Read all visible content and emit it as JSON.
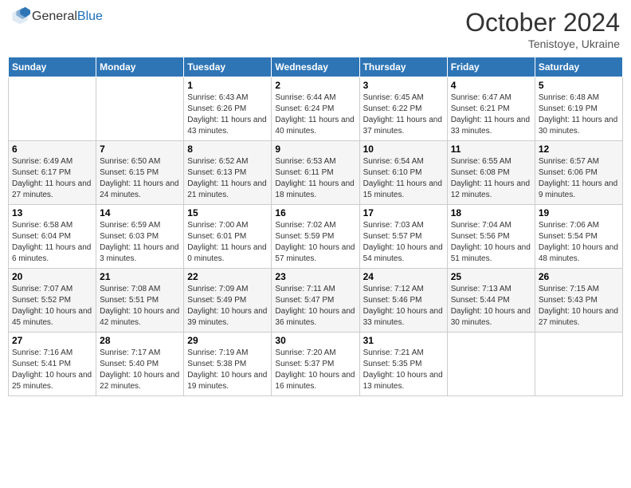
{
  "header": {
    "logo_general": "General",
    "logo_blue": "Blue",
    "month_title": "October 2024",
    "subtitle": "Tenistoye, Ukraine"
  },
  "days_of_week": [
    "Sunday",
    "Monday",
    "Tuesday",
    "Wednesday",
    "Thursday",
    "Friday",
    "Saturday"
  ],
  "weeks": [
    [
      {
        "day": "",
        "sunrise": "",
        "sunset": "",
        "daylight": ""
      },
      {
        "day": "",
        "sunrise": "",
        "sunset": "",
        "daylight": ""
      },
      {
        "day": "1",
        "sunrise": "Sunrise: 6:43 AM",
        "sunset": "Sunset: 6:26 PM",
        "daylight": "Daylight: 11 hours and 43 minutes."
      },
      {
        "day": "2",
        "sunrise": "Sunrise: 6:44 AM",
        "sunset": "Sunset: 6:24 PM",
        "daylight": "Daylight: 11 hours and 40 minutes."
      },
      {
        "day": "3",
        "sunrise": "Sunrise: 6:45 AM",
        "sunset": "Sunset: 6:22 PM",
        "daylight": "Daylight: 11 hours and 37 minutes."
      },
      {
        "day": "4",
        "sunrise": "Sunrise: 6:47 AM",
        "sunset": "Sunset: 6:21 PM",
        "daylight": "Daylight: 11 hours and 33 minutes."
      },
      {
        "day": "5",
        "sunrise": "Sunrise: 6:48 AM",
        "sunset": "Sunset: 6:19 PM",
        "daylight": "Daylight: 11 hours and 30 minutes."
      }
    ],
    [
      {
        "day": "6",
        "sunrise": "Sunrise: 6:49 AM",
        "sunset": "Sunset: 6:17 PM",
        "daylight": "Daylight: 11 hours and 27 minutes."
      },
      {
        "day": "7",
        "sunrise": "Sunrise: 6:50 AM",
        "sunset": "Sunset: 6:15 PM",
        "daylight": "Daylight: 11 hours and 24 minutes."
      },
      {
        "day": "8",
        "sunrise": "Sunrise: 6:52 AM",
        "sunset": "Sunset: 6:13 PM",
        "daylight": "Daylight: 11 hours and 21 minutes."
      },
      {
        "day": "9",
        "sunrise": "Sunrise: 6:53 AM",
        "sunset": "Sunset: 6:11 PM",
        "daylight": "Daylight: 11 hours and 18 minutes."
      },
      {
        "day": "10",
        "sunrise": "Sunrise: 6:54 AM",
        "sunset": "Sunset: 6:10 PM",
        "daylight": "Daylight: 11 hours and 15 minutes."
      },
      {
        "day": "11",
        "sunrise": "Sunrise: 6:55 AM",
        "sunset": "Sunset: 6:08 PM",
        "daylight": "Daylight: 11 hours and 12 minutes."
      },
      {
        "day": "12",
        "sunrise": "Sunrise: 6:57 AM",
        "sunset": "Sunset: 6:06 PM",
        "daylight": "Daylight: 11 hours and 9 minutes."
      }
    ],
    [
      {
        "day": "13",
        "sunrise": "Sunrise: 6:58 AM",
        "sunset": "Sunset: 6:04 PM",
        "daylight": "Daylight: 11 hours and 6 minutes."
      },
      {
        "day": "14",
        "sunrise": "Sunrise: 6:59 AM",
        "sunset": "Sunset: 6:03 PM",
        "daylight": "Daylight: 11 hours and 3 minutes."
      },
      {
        "day": "15",
        "sunrise": "Sunrise: 7:00 AM",
        "sunset": "Sunset: 6:01 PM",
        "daylight": "Daylight: 11 hours and 0 minutes."
      },
      {
        "day": "16",
        "sunrise": "Sunrise: 7:02 AM",
        "sunset": "Sunset: 5:59 PM",
        "daylight": "Daylight: 10 hours and 57 minutes."
      },
      {
        "day": "17",
        "sunrise": "Sunrise: 7:03 AM",
        "sunset": "Sunset: 5:57 PM",
        "daylight": "Daylight: 10 hours and 54 minutes."
      },
      {
        "day": "18",
        "sunrise": "Sunrise: 7:04 AM",
        "sunset": "Sunset: 5:56 PM",
        "daylight": "Daylight: 10 hours and 51 minutes."
      },
      {
        "day": "19",
        "sunrise": "Sunrise: 7:06 AM",
        "sunset": "Sunset: 5:54 PM",
        "daylight": "Daylight: 10 hours and 48 minutes."
      }
    ],
    [
      {
        "day": "20",
        "sunrise": "Sunrise: 7:07 AM",
        "sunset": "Sunset: 5:52 PM",
        "daylight": "Daylight: 10 hours and 45 minutes."
      },
      {
        "day": "21",
        "sunrise": "Sunrise: 7:08 AM",
        "sunset": "Sunset: 5:51 PM",
        "daylight": "Daylight: 10 hours and 42 minutes."
      },
      {
        "day": "22",
        "sunrise": "Sunrise: 7:09 AM",
        "sunset": "Sunset: 5:49 PM",
        "daylight": "Daylight: 10 hours and 39 minutes."
      },
      {
        "day": "23",
        "sunrise": "Sunrise: 7:11 AM",
        "sunset": "Sunset: 5:47 PM",
        "daylight": "Daylight: 10 hours and 36 minutes."
      },
      {
        "day": "24",
        "sunrise": "Sunrise: 7:12 AM",
        "sunset": "Sunset: 5:46 PM",
        "daylight": "Daylight: 10 hours and 33 minutes."
      },
      {
        "day": "25",
        "sunrise": "Sunrise: 7:13 AM",
        "sunset": "Sunset: 5:44 PM",
        "daylight": "Daylight: 10 hours and 30 minutes."
      },
      {
        "day": "26",
        "sunrise": "Sunrise: 7:15 AM",
        "sunset": "Sunset: 5:43 PM",
        "daylight": "Daylight: 10 hours and 27 minutes."
      }
    ],
    [
      {
        "day": "27",
        "sunrise": "Sunrise: 7:16 AM",
        "sunset": "Sunset: 5:41 PM",
        "daylight": "Daylight: 10 hours and 25 minutes."
      },
      {
        "day": "28",
        "sunrise": "Sunrise: 7:17 AM",
        "sunset": "Sunset: 5:40 PM",
        "daylight": "Daylight: 10 hours and 22 minutes."
      },
      {
        "day": "29",
        "sunrise": "Sunrise: 7:19 AM",
        "sunset": "Sunset: 5:38 PM",
        "daylight": "Daylight: 10 hours and 19 minutes."
      },
      {
        "day": "30",
        "sunrise": "Sunrise: 7:20 AM",
        "sunset": "Sunset: 5:37 PM",
        "daylight": "Daylight: 10 hours and 16 minutes."
      },
      {
        "day": "31",
        "sunrise": "Sunrise: 7:21 AM",
        "sunset": "Sunset: 5:35 PM",
        "daylight": "Daylight: 10 hours and 13 minutes."
      },
      {
        "day": "",
        "sunrise": "",
        "sunset": "",
        "daylight": ""
      },
      {
        "day": "",
        "sunrise": "",
        "sunset": "",
        "daylight": ""
      }
    ]
  ]
}
